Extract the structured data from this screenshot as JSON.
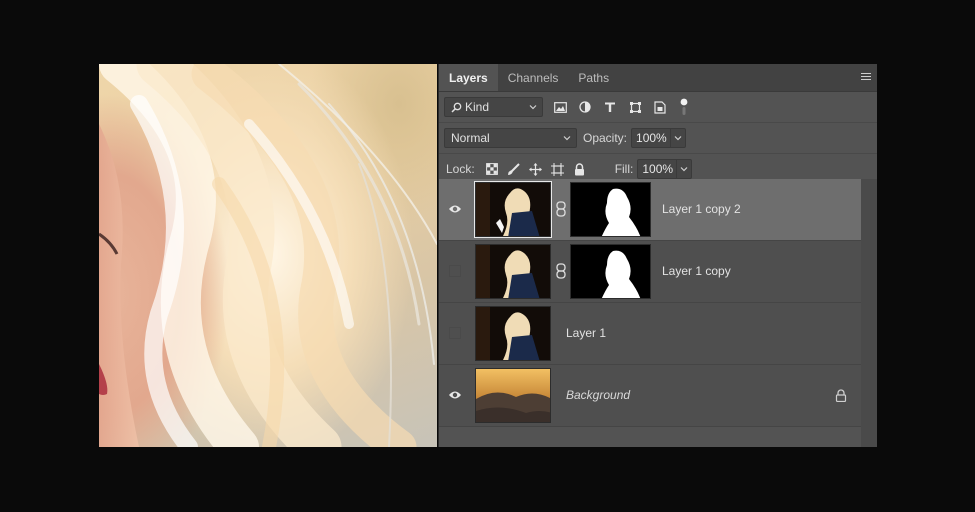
{
  "panel": {
    "tabs": [
      {
        "label": "Layers",
        "active": true
      },
      {
        "label": "Channels",
        "active": false
      },
      {
        "label": "Paths",
        "active": false
      }
    ]
  },
  "filter": {
    "kind_label": "Kind",
    "icons": [
      "image-filter-icon",
      "adjustment-filter-icon",
      "type-filter-icon",
      "shape-filter-icon",
      "smart-object-filter-icon",
      "filter-toggle-icon"
    ]
  },
  "blend": {
    "mode": "Normal",
    "opacity_label": "Opacity:",
    "opacity_value": "100%"
  },
  "lock": {
    "label": "Lock:",
    "fill_label": "Fill:",
    "fill_value": "100%",
    "icons": [
      "lock-transparent-pixels-icon",
      "lock-image-pixels-icon",
      "lock-position-icon",
      "lock-artboard-icon",
      "lock-all-icon"
    ]
  },
  "layers": [
    {
      "name": "Layer 1 copy 2",
      "visible": true,
      "selected": true,
      "has_mask": true
    },
    {
      "name": "Layer 1 copy",
      "visible": false,
      "selected": false,
      "has_mask": true
    },
    {
      "name": "Layer 1",
      "visible": false,
      "selected": false,
      "has_mask": false
    },
    {
      "name": "Background",
      "visible": true,
      "selected": false,
      "has_mask": false,
      "locked": true
    }
  ]
}
